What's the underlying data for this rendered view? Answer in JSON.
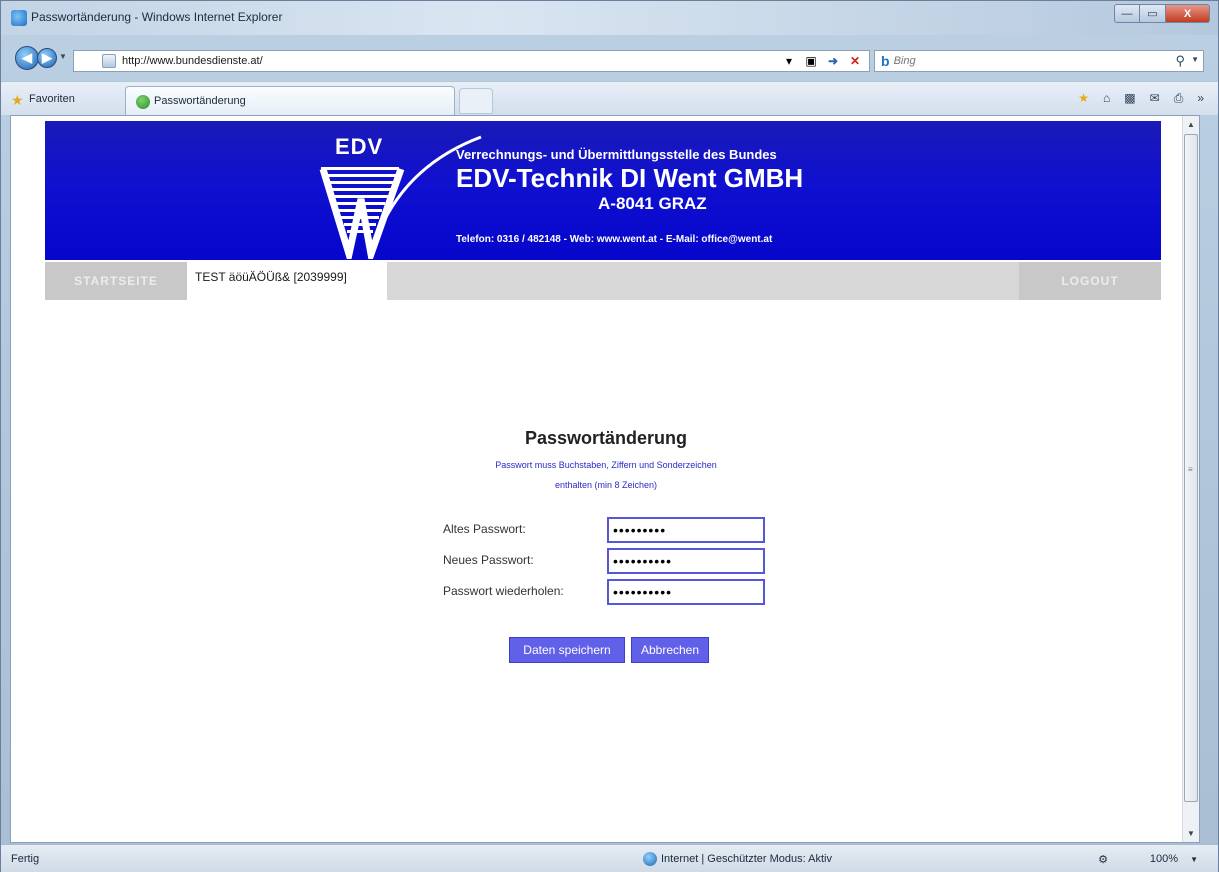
{
  "window": {
    "title": "Passwortänderung - Windows Internet Explorer",
    "buttons": {
      "minimize": "—",
      "maximize": "▭",
      "close": "X"
    }
  },
  "address_bar": {
    "url": "http://www.bundesdienste.at/",
    "search_placeholder": "Bing",
    "bing_logo": "b"
  },
  "favorites_bar": {
    "favorites_label": "Favoriten",
    "tab_label": "Passwortänderung"
  },
  "banner": {
    "logo_text": "EDV",
    "line1": "Verrechnungs- und Übermittlungsstelle des Bundes",
    "line2": "EDV-Technik DI Went GMBH",
    "line3": "A-8041 GRAZ",
    "contact": "Telefon: 0316 / 482148  -  Web: www.went.at  -  E-Mail: office@went.at"
  },
  "nav": {
    "start": "STARTSEITE",
    "user": "TEST äöüÄÖÜß& [2039999]",
    "logout": "LOGOUT"
  },
  "form": {
    "title": "Passwortänderung",
    "hint_line1": "Passwort muss Buchstaben, Ziffern und Sonderzeichen",
    "hint_line2": "enthalten (min 8 Zeichen)",
    "fields": [
      {
        "label": "Altes Passwort:",
        "value": "•••••••••"
      },
      {
        "label": "Neues Passwort:",
        "value": "••••••••••"
      },
      {
        "label": "Passwort wiederholen:",
        "value": "••••••••••"
      }
    ],
    "save_button": "Daten speichern",
    "cancel_button": "Abbrechen"
  },
  "status_bar": {
    "left": "Fertig",
    "zone": "Internet | Geschützter Modus: Aktiv",
    "zoom": "100%"
  },
  "colors": {
    "banner_blue": "#0606cc",
    "button_blue": "#6060e8",
    "hint_blue": "#2929c8",
    "nav_gray": "#c8c8c8"
  }
}
